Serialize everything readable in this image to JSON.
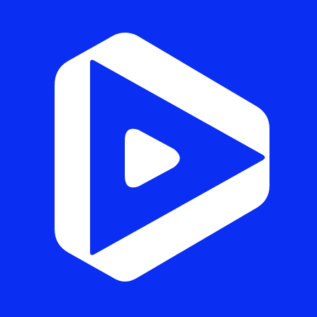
{
  "icon": {
    "name": "play-logo-icon",
    "colors": {
      "background": "#0A2EF2",
      "foreground": "#FFFFFF"
    }
  }
}
